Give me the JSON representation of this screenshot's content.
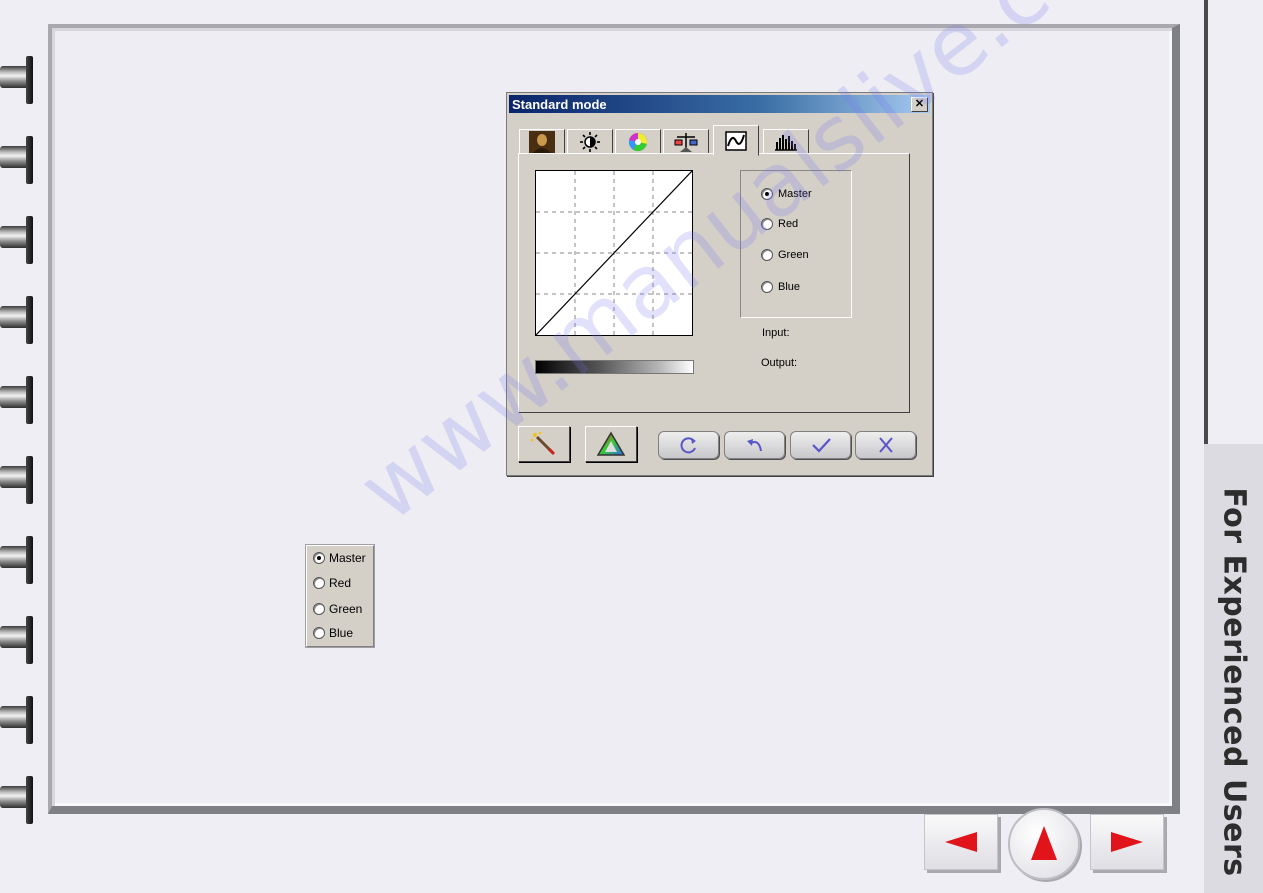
{
  "dialog": {
    "title": "Standard mode",
    "close_glyph": "✕",
    "tabs": [
      {
        "icon": "portrait-image-icon"
      },
      {
        "icon": "brightness-icon"
      },
      {
        "icon": "color-wheel-icon"
      },
      {
        "icon": "balance-scale-icon"
      },
      {
        "icon": "tone-curve-icon",
        "active": true
      },
      {
        "icon": "histogram-icon"
      }
    ],
    "channels": [
      "Master",
      "Red",
      "Green",
      "Blue"
    ],
    "selected_channel": "Master",
    "input_label": "Input:",
    "output_label": "Output:",
    "tool_buttons": [
      "magic-wand-icon",
      "color-triangle-icon"
    ],
    "action_buttons": [
      "refresh-icon",
      "undo-icon",
      "ok-check-icon",
      "cancel-x-icon"
    ]
  },
  "channel_selector": {
    "options": [
      "Master",
      "Red",
      "Green",
      "Blue"
    ],
    "selected": "Master"
  },
  "sidebar": {
    "title": "For Experienced Users"
  },
  "navigation": {
    "prev_icon": "previous-arrow-icon",
    "up_icon": "up-arrow-icon",
    "next_icon": "next-arrow-icon"
  },
  "watermark": "www.manualslive.com",
  "colors": {
    "accent_red": "#e0141a",
    "titlebar_blue": "#0a246a",
    "action_icon_blue": "#5a55c8"
  }
}
